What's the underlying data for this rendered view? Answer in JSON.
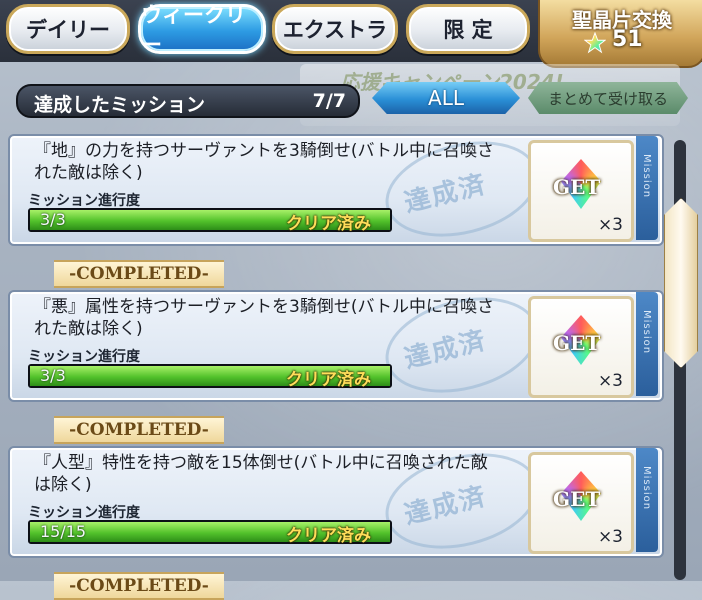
{
  "tabs": [
    {
      "label": "デイリー"
    },
    {
      "label": "ウィークリー"
    },
    {
      "label": "エクストラ"
    },
    {
      "label": "限 定"
    }
  ],
  "exchange": {
    "label": "聖晶片交換",
    "count": "51"
  },
  "banner_text": "応援キャンペーン2024!",
  "summary": {
    "label": "達成したミッション",
    "count": "7/7"
  },
  "filter_label": "ALL",
  "claim_all_label": "まとめて受け取る",
  "side_label": "Mission",
  "stamp_text": "達成済",
  "completed_text": "-COMPLETED-",
  "missions": [
    {
      "desc": "『地』の力を持つサーヴァントを3騎倒せ(バトル中に召喚された敵は除く)",
      "progress_label": "ミッション進行度",
      "progress": "3/3",
      "progress_fraction": 1.0,
      "status": "クリア済み",
      "reward_label": "GET",
      "reward_qty": "×3"
    },
    {
      "desc": "『悪』属性を持つサーヴァントを3騎倒せ(バトル中に召喚された敵は除く)",
      "progress_label": "ミッション進行度",
      "progress": "3/3",
      "progress_fraction": 1.0,
      "status": "クリア済み",
      "reward_label": "GET",
      "reward_qty": "×3"
    },
    {
      "desc": "『人型』特性を持つ敵を15体倒せ(バトル中に召喚された敵は除く)",
      "progress_label": "ミッション進行度",
      "progress": "15/15",
      "progress_fraction": 1.0,
      "status": "クリア済み",
      "reward_label": "GET",
      "reward_qty": "×3"
    }
  ]
}
